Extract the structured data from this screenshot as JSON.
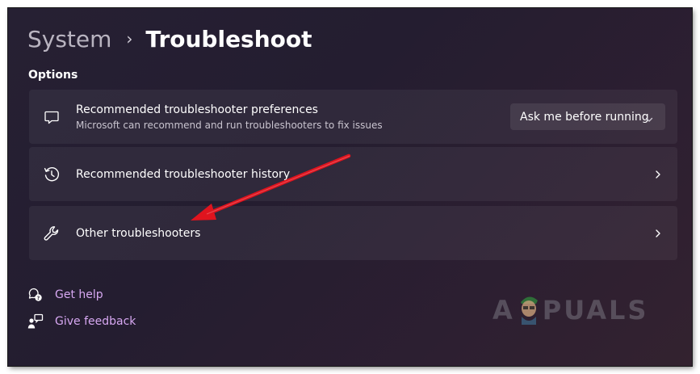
{
  "breadcrumb": {
    "parent": "System",
    "separator": "›",
    "current": "Troubleshoot"
  },
  "options_heading": "Options",
  "cards": [
    {
      "title": "Recommended troubleshooter preferences",
      "subtitle": "Microsoft can recommend and run troubleshooters to fix issues",
      "icon": "chat-bubble-icon",
      "dropdown_value": "Ask me before running"
    },
    {
      "title": "Recommended troubleshooter history",
      "icon": "history-icon"
    },
    {
      "title": "Other troubleshooters",
      "icon": "wrench-icon"
    }
  ],
  "links": [
    {
      "label": "Get help",
      "icon": "help-chat-icon"
    },
    {
      "label": "Give feedback",
      "icon": "feedback-icon"
    }
  ],
  "watermark": {
    "prefix": "A",
    "suffix": "PUALS"
  },
  "colors": {
    "link": "#d7a8f2",
    "arrow": "#e0141e",
    "background": "#262033"
  }
}
